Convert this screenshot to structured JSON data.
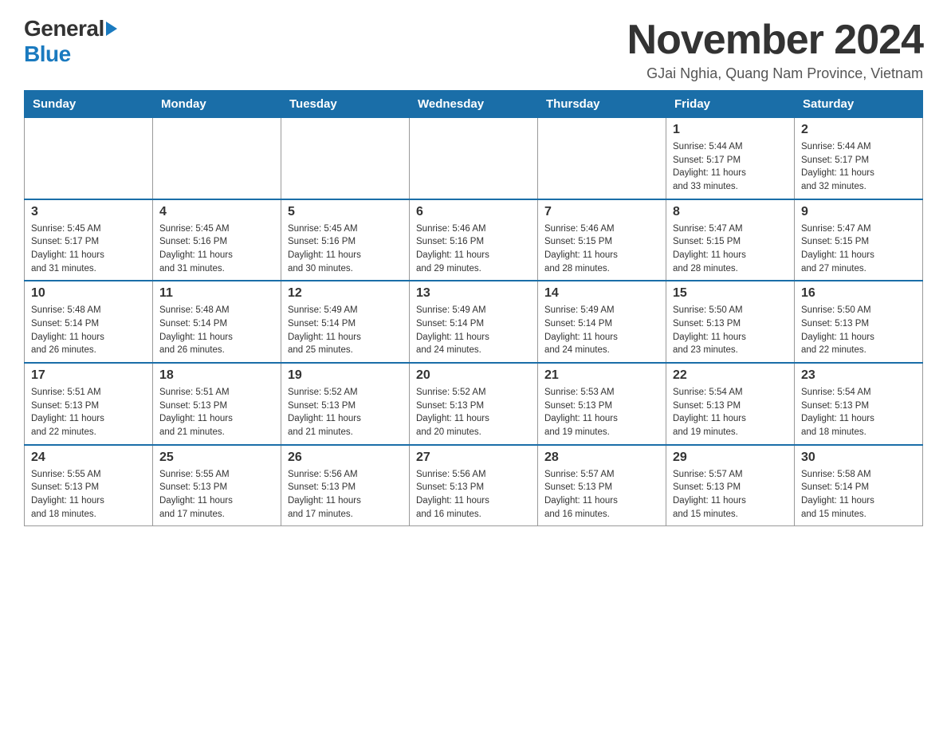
{
  "logo": {
    "general": "General",
    "blue": "Blue"
  },
  "title": "November 2024",
  "location": "GJai Nghia, Quang Nam Province, Vietnam",
  "weekdays": [
    "Sunday",
    "Monday",
    "Tuesday",
    "Wednesday",
    "Thursday",
    "Friday",
    "Saturday"
  ],
  "weeks": [
    [
      {
        "day": "",
        "info": ""
      },
      {
        "day": "",
        "info": ""
      },
      {
        "day": "",
        "info": ""
      },
      {
        "day": "",
        "info": ""
      },
      {
        "day": "",
        "info": ""
      },
      {
        "day": "1",
        "info": "Sunrise: 5:44 AM\nSunset: 5:17 PM\nDaylight: 11 hours\nand 33 minutes."
      },
      {
        "day": "2",
        "info": "Sunrise: 5:44 AM\nSunset: 5:17 PM\nDaylight: 11 hours\nand 32 minutes."
      }
    ],
    [
      {
        "day": "3",
        "info": "Sunrise: 5:45 AM\nSunset: 5:17 PM\nDaylight: 11 hours\nand 31 minutes."
      },
      {
        "day": "4",
        "info": "Sunrise: 5:45 AM\nSunset: 5:16 PM\nDaylight: 11 hours\nand 31 minutes."
      },
      {
        "day": "5",
        "info": "Sunrise: 5:45 AM\nSunset: 5:16 PM\nDaylight: 11 hours\nand 30 minutes."
      },
      {
        "day": "6",
        "info": "Sunrise: 5:46 AM\nSunset: 5:16 PM\nDaylight: 11 hours\nand 29 minutes."
      },
      {
        "day": "7",
        "info": "Sunrise: 5:46 AM\nSunset: 5:15 PM\nDaylight: 11 hours\nand 28 minutes."
      },
      {
        "day": "8",
        "info": "Sunrise: 5:47 AM\nSunset: 5:15 PM\nDaylight: 11 hours\nand 28 minutes."
      },
      {
        "day": "9",
        "info": "Sunrise: 5:47 AM\nSunset: 5:15 PM\nDaylight: 11 hours\nand 27 minutes."
      }
    ],
    [
      {
        "day": "10",
        "info": "Sunrise: 5:48 AM\nSunset: 5:14 PM\nDaylight: 11 hours\nand 26 minutes."
      },
      {
        "day": "11",
        "info": "Sunrise: 5:48 AM\nSunset: 5:14 PM\nDaylight: 11 hours\nand 26 minutes."
      },
      {
        "day": "12",
        "info": "Sunrise: 5:49 AM\nSunset: 5:14 PM\nDaylight: 11 hours\nand 25 minutes."
      },
      {
        "day": "13",
        "info": "Sunrise: 5:49 AM\nSunset: 5:14 PM\nDaylight: 11 hours\nand 24 minutes."
      },
      {
        "day": "14",
        "info": "Sunrise: 5:49 AM\nSunset: 5:14 PM\nDaylight: 11 hours\nand 24 minutes."
      },
      {
        "day": "15",
        "info": "Sunrise: 5:50 AM\nSunset: 5:13 PM\nDaylight: 11 hours\nand 23 minutes."
      },
      {
        "day": "16",
        "info": "Sunrise: 5:50 AM\nSunset: 5:13 PM\nDaylight: 11 hours\nand 22 minutes."
      }
    ],
    [
      {
        "day": "17",
        "info": "Sunrise: 5:51 AM\nSunset: 5:13 PM\nDaylight: 11 hours\nand 22 minutes."
      },
      {
        "day": "18",
        "info": "Sunrise: 5:51 AM\nSunset: 5:13 PM\nDaylight: 11 hours\nand 21 minutes."
      },
      {
        "day": "19",
        "info": "Sunrise: 5:52 AM\nSunset: 5:13 PM\nDaylight: 11 hours\nand 21 minutes."
      },
      {
        "day": "20",
        "info": "Sunrise: 5:52 AM\nSunset: 5:13 PM\nDaylight: 11 hours\nand 20 minutes."
      },
      {
        "day": "21",
        "info": "Sunrise: 5:53 AM\nSunset: 5:13 PM\nDaylight: 11 hours\nand 19 minutes."
      },
      {
        "day": "22",
        "info": "Sunrise: 5:54 AM\nSunset: 5:13 PM\nDaylight: 11 hours\nand 19 minutes."
      },
      {
        "day": "23",
        "info": "Sunrise: 5:54 AM\nSunset: 5:13 PM\nDaylight: 11 hours\nand 18 minutes."
      }
    ],
    [
      {
        "day": "24",
        "info": "Sunrise: 5:55 AM\nSunset: 5:13 PM\nDaylight: 11 hours\nand 18 minutes."
      },
      {
        "day": "25",
        "info": "Sunrise: 5:55 AM\nSunset: 5:13 PM\nDaylight: 11 hours\nand 17 minutes."
      },
      {
        "day": "26",
        "info": "Sunrise: 5:56 AM\nSunset: 5:13 PM\nDaylight: 11 hours\nand 17 minutes."
      },
      {
        "day": "27",
        "info": "Sunrise: 5:56 AM\nSunset: 5:13 PM\nDaylight: 11 hours\nand 16 minutes."
      },
      {
        "day": "28",
        "info": "Sunrise: 5:57 AM\nSunset: 5:13 PM\nDaylight: 11 hours\nand 16 minutes."
      },
      {
        "day": "29",
        "info": "Sunrise: 5:57 AM\nSunset: 5:13 PM\nDaylight: 11 hours\nand 15 minutes."
      },
      {
        "day": "30",
        "info": "Sunrise: 5:58 AM\nSunset: 5:14 PM\nDaylight: 11 hours\nand 15 minutes."
      }
    ]
  ]
}
